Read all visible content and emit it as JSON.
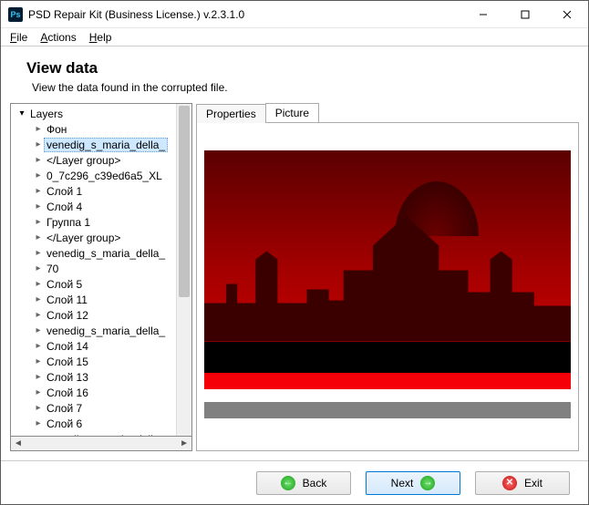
{
  "window": {
    "title": "PSD Repair Kit (Business License.) v.2.3.1.0",
    "appIconText": "Ps"
  },
  "menu": {
    "file": "File",
    "actions": "Actions",
    "help": "Help"
  },
  "heading": {
    "title": "View data",
    "subtitle": "View the data found in the corrupted file."
  },
  "tree": {
    "root": "Layers",
    "items": [
      "Фон",
      "venedig_s_maria_della_",
      "</Layer group>",
      "0_7c296_c39ed6a5_XL",
      "Слой 1",
      "Слой 4",
      "Группа 1",
      "</Layer group>",
      "venedig_s_maria_della_",
      "70",
      "Слой 5",
      "Слой 11",
      "Слой 12",
      "venedig_s_maria_della_",
      "Слой 14",
      "Слой 15",
      "Слой 13",
      "Слой 16",
      "Слой 7",
      "Слой 6",
      "venedig_s_maria_della_"
    ],
    "selectedIndex": 1
  },
  "tabs": {
    "properties": "Properties",
    "picture": "Picture",
    "active": "picture"
  },
  "buttons": {
    "back": "Back",
    "next": "Next",
    "exit": "Exit"
  }
}
